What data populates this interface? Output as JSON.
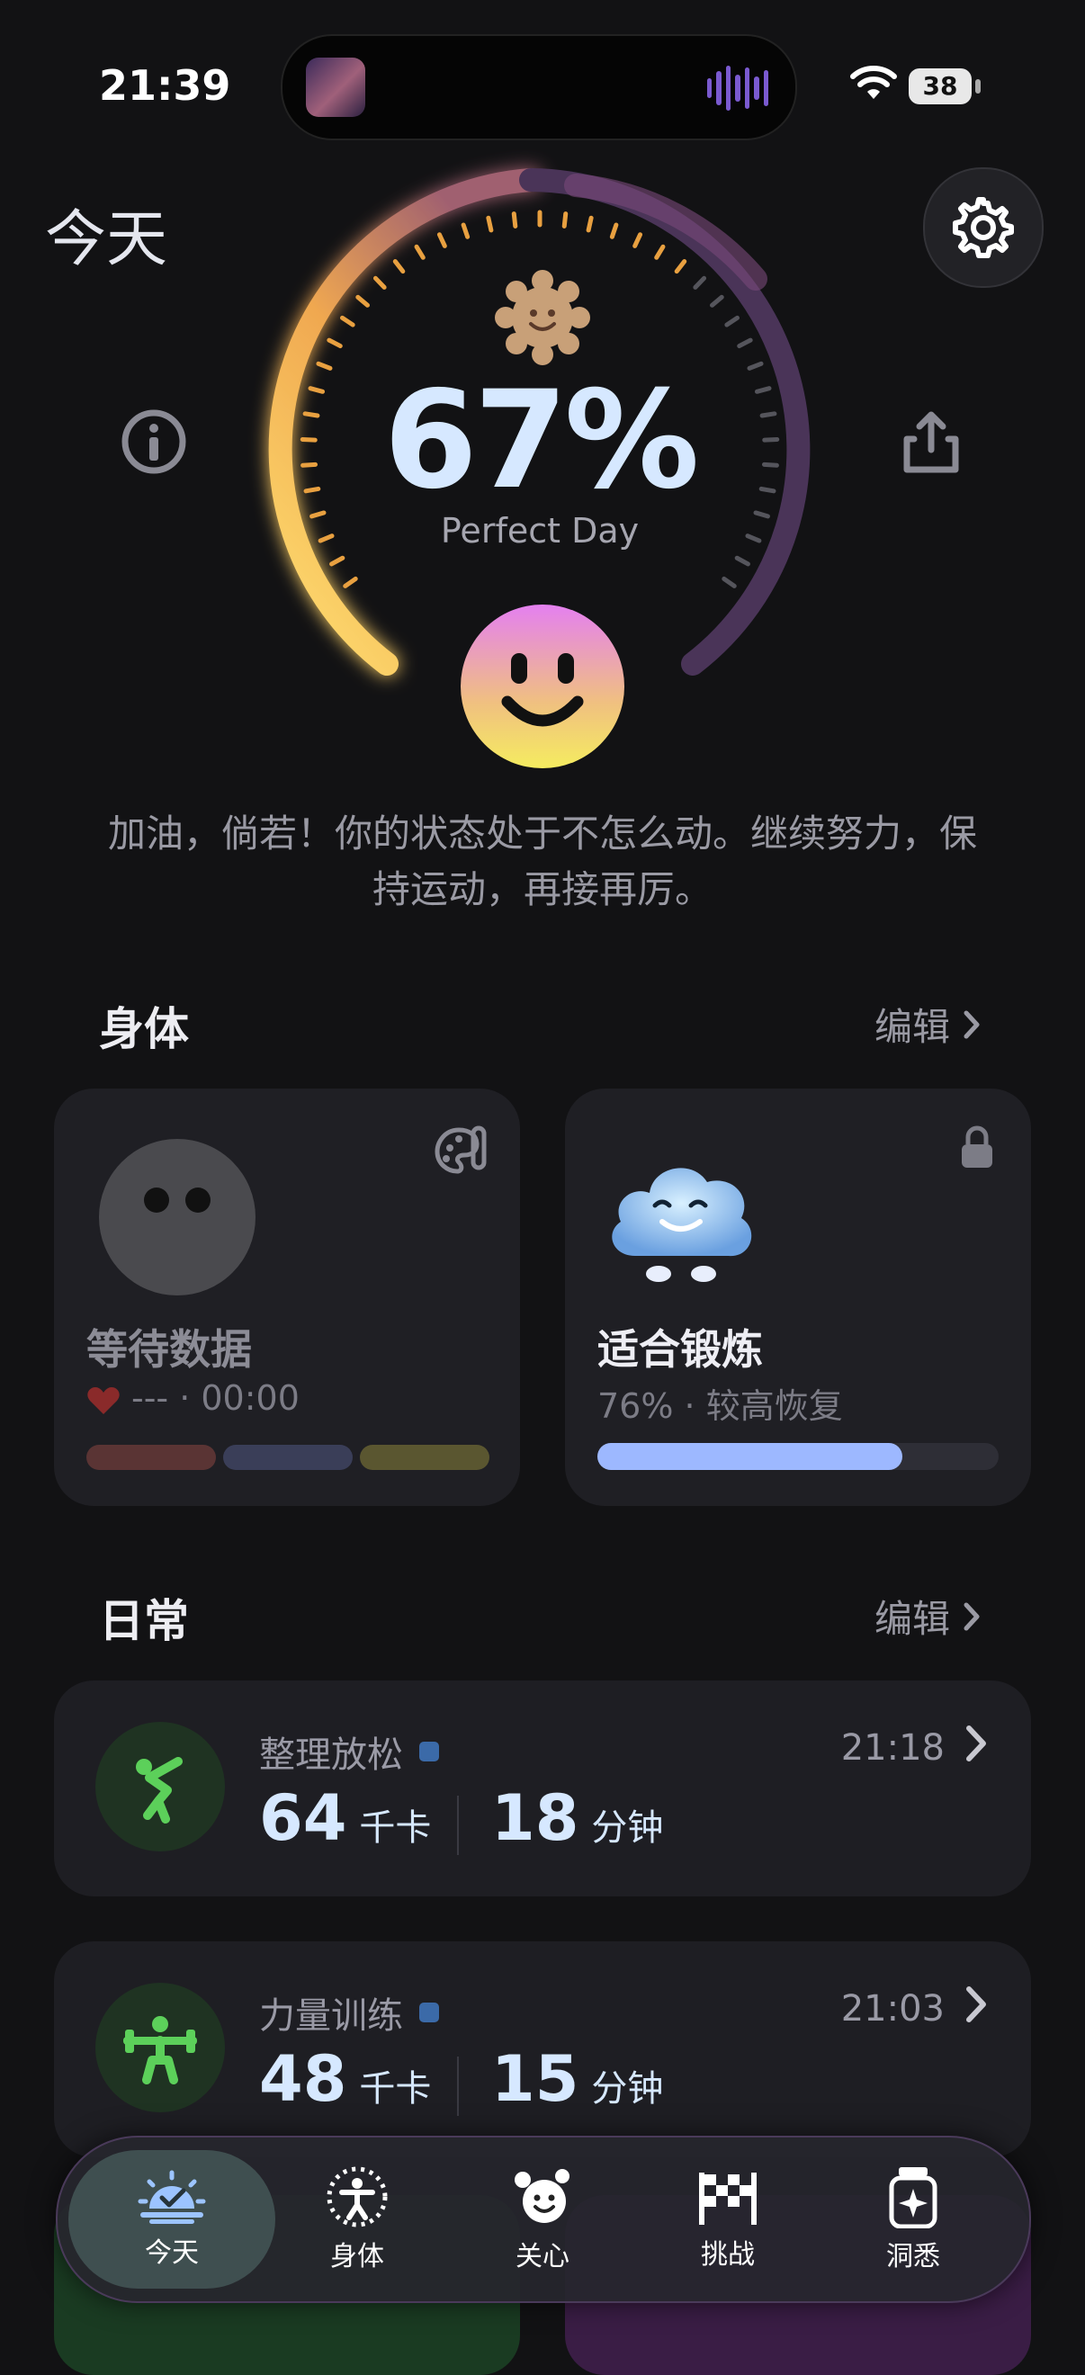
{
  "status_bar": {
    "time": "21:39",
    "battery": "38"
  },
  "header": {
    "title": "今天"
  },
  "score": {
    "percent": "67%",
    "label": "Perfect Day",
    "progress_fraction": 0.67,
    "message": "加油，倘若！你的状态处于不怎么动。继续努力，保持运动，再接再厉。"
  },
  "body_section": {
    "title": "身体",
    "edit_label": "编辑",
    "wait_card": {
      "title": "等待数据",
      "sub": "--- · 00:00"
    },
    "train_card": {
      "title": "适合锻炼",
      "sub": "76% · 较高恢复",
      "progress_fraction": 0.76
    }
  },
  "daily_section": {
    "title": "日常",
    "edit_label": "编辑",
    "activities": [
      {
        "name": "整理放松",
        "time": "21:18",
        "kcal": "64",
        "kcal_unit": "千卡",
        "minutes": "18",
        "minutes_unit": "分钟"
      },
      {
        "name": "力量训练",
        "time": "21:03",
        "kcal": "48",
        "kcal_unit": "千卡",
        "minutes": "15",
        "minutes_unit": "分钟"
      }
    ]
  },
  "tabbar": {
    "tabs": [
      {
        "label": "今天",
        "icon": "today-icon"
      },
      {
        "label": "身体",
        "icon": "body-icon"
      },
      {
        "label": "关心",
        "icon": "care-icon"
      },
      {
        "label": "挑战",
        "icon": "challenge-icon"
      },
      {
        "label": "洞悉",
        "icon": "insight-icon"
      }
    ]
  },
  "colors": {
    "accent_yellow": "#f5c84a",
    "accent_purple": "#6a4a8a",
    "metric_blue": "#d6e8ff",
    "activity_green": "#5cd05a"
  }
}
